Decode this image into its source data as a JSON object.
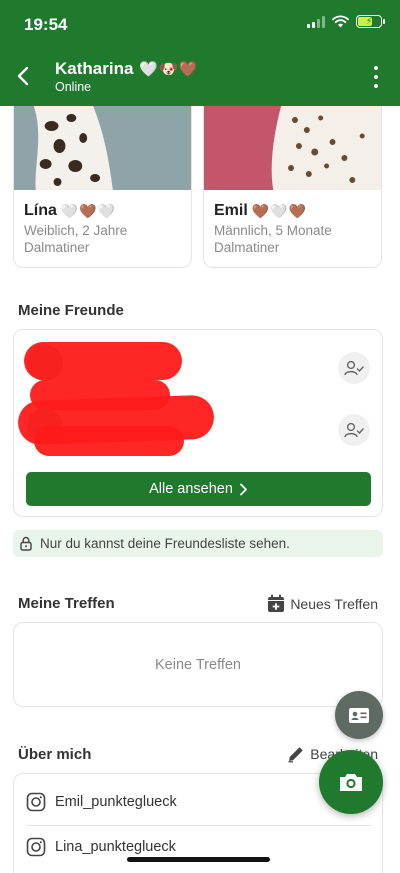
{
  "status_bar": {
    "time": "19:54"
  },
  "header": {
    "name": "Katharina",
    "name_emoji": "🤍🐶🤎",
    "status": "Online"
  },
  "dogs": [
    {
      "name": "Lína",
      "emoji": "🤍🤎🤍",
      "details": "Weiblich, 2 Jahre",
      "breed": "Dalmatiner"
    },
    {
      "name": "Emil",
      "emoji": "🤎🤍🤎",
      "details": "Männlich, 5 Monate",
      "breed": "Dalmatiner"
    }
  ],
  "friends": {
    "title": "Meine Freunde",
    "see_all": "Alle ansehen",
    "privacy_note": "Nur du kannst deine Freundesliste sehen."
  },
  "meetings": {
    "title": "Meine Treffen",
    "new_label": "Neues Treffen",
    "empty": "Keine Treffen"
  },
  "about": {
    "title": "Über mich",
    "edit_label": "Bearbeiten",
    "socials": [
      "Emil_punkteglueck",
      "Lina_punkteglueck"
    ]
  },
  "colors": {
    "brand_green": "#1f7a2e",
    "privacy_bg": "#e9f4ea",
    "fab_grey": "#5f6a63"
  },
  "icons": [
    "back-icon",
    "more-vert-icon",
    "wifi-icon",
    "battery-icon",
    "person-check-icon",
    "chevron-right-icon",
    "lock-icon",
    "calendar-add-icon",
    "pencil-icon",
    "instagram-icon",
    "contact-card-icon",
    "camera-icon"
  ]
}
